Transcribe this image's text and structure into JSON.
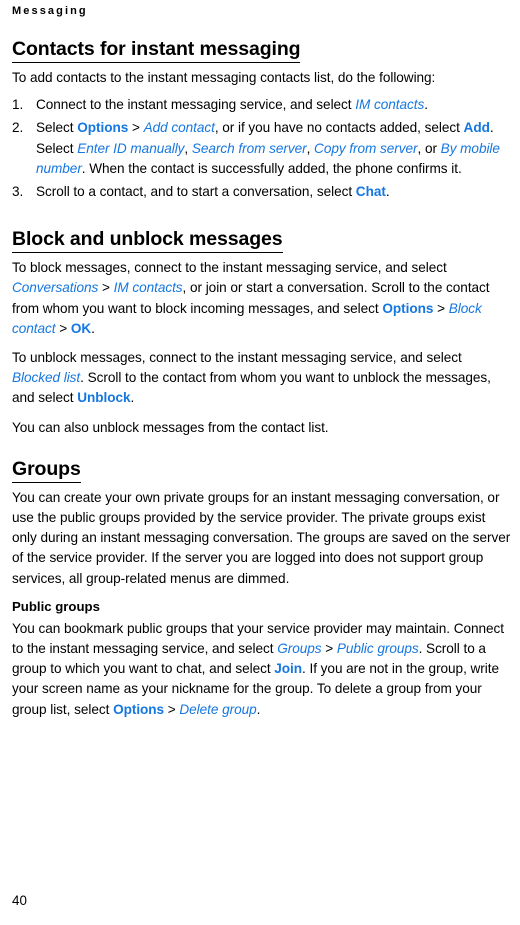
{
  "running_header": "Messaging",
  "page_number": "40",
  "colors": {
    "link_blue": "#1577e0",
    "text_black": "#000000",
    "page_background": "#ffffff"
  },
  "sections": [
    {
      "heading": "Contacts for instant messaging",
      "intro": "To add contacts to the instant messaging contacts list, do the following:",
      "steps": [
        {
          "number": "1.",
          "parts": [
            {
              "text": "Connect to the instant messaging service, and select ",
              "style": "plain"
            },
            {
              "text": "IM contacts",
              "style": "menu-item"
            },
            {
              "text": ".",
              "style": "plain"
            }
          ]
        },
        {
          "number": "2.",
          "parts": [
            {
              "text": "Select ",
              "style": "plain"
            },
            {
              "text": "Options",
              "style": "menu-button"
            },
            {
              "text": " > ",
              "style": "plain"
            },
            {
              "text": "Add contact",
              "style": "menu-item"
            },
            {
              "text": ", or if you have no contacts added, select ",
              "style": "plain"
            },
            {
              "text": "Add",
              "style": "menu-button"
            },
            {
              "text": ". Select ",
              "style": "plain"
            },
            {
              "text": "Enter ID manually",
              "style": "menu-item"
            },
            {
              "text": ", ",
              "style": "plain"
            },
            {
              "text": "Search from server",
              "style": "menu-item"
            },
            {
              "text": ", ",
              "style": "plain"
            },
            {
              "text": "Copy from server",
              "style": "menu-item"
            },
            {
              "text": ", or ",
              "style": "plain"
            },
            {
              "text": "By mobile number",
              "style": "menu-item"
            },
            {
              "text": ". When the contact is successfully added, the phone confirms it.",
              "style": "plain"
            }
          ]
        },
        {
          "number": "3.",
          "parts": [
            {
              "text": "Scroll to a contact, and to start a conversation, select ",
              "style": "plain"
            },
            {
              "text": "Chat",
              "style": "menu-button"
            },
            {
              "text": ".",
              "style": "plain"
            }
          ]
        }
      ]
    },
    {
      "heading": "Block and unblock messages",
      "paragraphs": [
        [
          {
            "text": "To block messages, connect to the instant messaging service, and select ",
            "style": "plain"
          },
          {
            "text": "Conversations",
            "style": "menu-item"
          },
          {
            "text": " > ",
            "style": "plain"
          },
          {
            "text": "IM contacts",
            "style": "menu-item"
          },
          {
            "text": ", or join or start a conversation. Scroll to the contact from whom you want to block incoming messages, and select ",
            "style": "plain"
          },
          {
            "text": "Options",
            "style": "menu-button"
          },
          {
            "text": " > ",
            "style": "plain"
          },
          {
            "text": "Block contact",
            "style": "menu-item"
          },
          {
            "text": " > ",
            "style": "plain"
          },
          {
            "text": "OK",
            "style": "menu-button"
          },
          {
            "text": ".",
            "style": "plain"
          }
        ],
        [
          {
            "text": "To unblock messages, connect to the instant messaging service, and select ",
            "style": "plain"
          },
          {
            "text": "Blocked list",
            "style": "menu-item"
          },
          {
            "text": ". Scroll to the contact from whom you want to unblock the messages, and select ",
            "style": "plain"
          },
          {
            "text": "Unblock",
            "style": "menu-button"
          },
          {
            "text": ".",
            "style": "plain"
          }
        ],
        [
          {
            "text": "You can also unblock messages from the contact list.",
            "style": "plain"
          }
        ]
      ]
    },
    {
      "heading": "Groups",
      "paragraphs": [
        [
          {
            "text": "You can create your own private groups for an instant messaging conversation, or use the public groups provided by the service provider. The private groups exist only during an instant messaging conversation. The groups are saved on the server of the service provider. If the server you are logged into does not support group services, all group-related menus are dimmed.",
            "style": "plain"
          }
        ]
      ],
      "subsection": {
        "heading": "Public groups",
        "paragraphs": [
          [
            {
              "text": "You can bookmark public groups that your service provider may maintain. Connect to the instant messaging service, and select ",
              "style": "plain"
            },
            {
              "text": "Groups",
              "style": "menu-item"
            },
            {
              "text": " > ",
              "style": "plain"
            },
            {
              "text": "Public groups",
              "style": "menu-item"
            },
            {
              "text": ". Scroll to a group to which you want to chat, and select ",
              "style": "plain"
            },
            {
              "text": "Join",
              "style": "menu-button"
            },
            {
              "text": ". If you are not in the group, write your screen name as your nickname for the group. To delete a group from your group list, select ",
              "style": "plain"
            },
            {
              "text": "Options",
              "style": "menu-button"
            },
            {
              "text": " > ",
              "style": "plain"
            },
            {
              "text": "Delete group",
              "style": "menu-item"
            },
            {
              "text": ".",
              "style": "plain"
            }
          ]
        ]
      }
    }
  ]
}
